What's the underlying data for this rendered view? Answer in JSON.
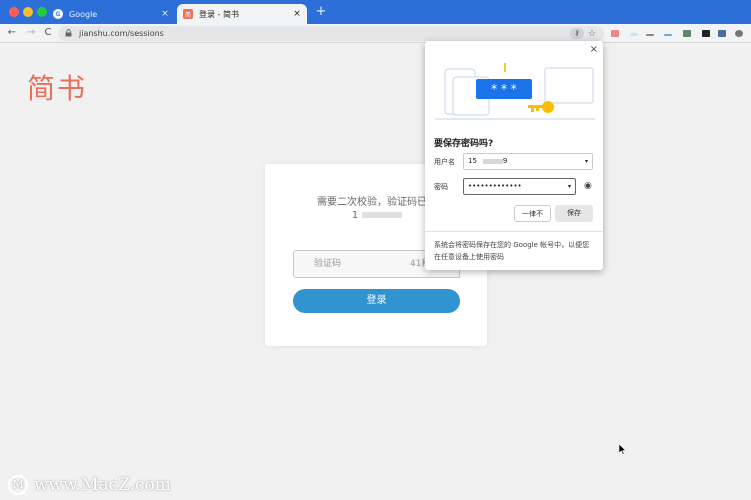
{
  "browser": {
    "tabs": [
      {
        "title": "Google",
        "active": false,
        "favicon": "G"
      },
      {
        "title": "登录 - 简书",
        "active": true,
        "favicon": "简"
      }
    ],
    "new_tab_label": "+",
    "close_symbol": "×",
    "url": "jianshu.com/sessions",
    "icons": {
      "back": "←",
      "forward": "→",
      "reload": "C",
      "lock": "🔒",
      "key": "⚷",
      "star": "☆"
    }
  },
  "page": {
    "logo": "简书",
    "verify_text_line1": "需要二次校验，验证码已发",
    "verify_text_line2": "1",
    "code_placeholder": "验证码",
    "resend_text": "41秒",
    "login_button": "登录"
  },
  "popup": {
    "close_symbol": "×",
    "title": "要保存密码吗?",
    "username_label": "用户名",
    "username_value": "15",
    "username_tail": "9",
    "password_label": "密码",
    "password_value": "•••••••••••••",
    "caret": "▾",
    "eye_icon": "◉",
    "never_button": "一律不",
    "save_button": "保存",
    "footnote": "系统会将密码保存在您的 Google 帐号中，以便您在任意设备上使用密码",
    "illustration_text": "* * *"
  },
  "watermark": {
    "text": "www.MacZ.com",
    "badge": "M"
  },
  "colors": {
    "accent": "#ea6f5a",
    "button_blue": "#3194d0",
    "tab_bar": "#2d6fd8"
  }
}
